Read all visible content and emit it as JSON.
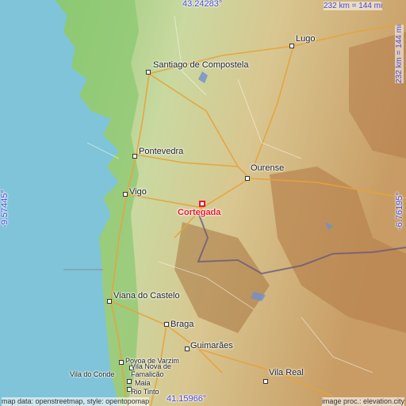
{
  "coords": {
    "lat_top": "43.24283°",
    "lat_bottom": "41.15966°",
    "lon_left": "-9.57445°",
    "lon_right": "-6.76195°"
  },
  "scale": {
    "horizontal": "232 km = 144 mi",
    "vertical": "232 km = 144 mi"
  },
  "focus_city": "Cortegada",
  "cities": {
    "lugo": "Lugo",
    "santiago": "Santiago de Compostela",
    "pontevedra": "Pontevedra",
    "vigo": "Vigo",
    "ourense": "Ourense",
    "viana": "Viana do Castelo",
    "braga": "Braga",
    "guimaraes": "Guimarães",
    "povoa": "Povoa de Varzim",
    "famalicao": "Vila Nova de Famalicão",
    "vila_conde": "Vila do Conde",
    "maia": "Maia",
    "rio_tinto": "Rio Tinto",
    "vila_real": "Vila Real"
  },
  "credits": {
    "left": "map data: openstreetmap, style: opentopomap",
    "right": "image proc.: elevation.city"
  },
  "colors": {
    "sea": "#7fc4d8",
    "lowland": "#a9d48a",
    "highland": "#c8a46a",
    "mountain": "#b07a4a",
    "focus": "#e8192c",
    "coord_text": "#4b4bd8"
  }
}
